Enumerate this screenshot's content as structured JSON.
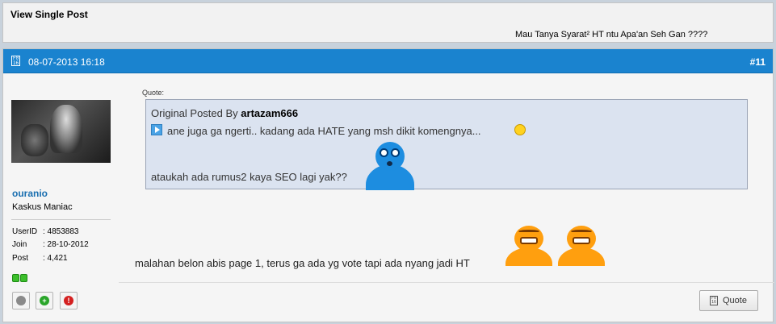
{
  "top": {
    "title": "View Single Post",
    "subject": "Mau Tanya Syarat² HT ntu Apa'an Seh Gan ????"
  },
  "post": {
    "date": "08-07-2013 16:18",
    "number": "#11",
    "date_icon_text": "F0 16"
  },
  "user": {
    "name": "ouranio",
    "title": "Kaskus Maniac",
    "info": [
      {
        "key": "UserID",
        "value": ": 4853883"
      },
      {
        "key": "Join",
        "value": ": 28-10-2012"
      },
      {
        "key": "Post",
        "value": ": 4,421"
      }
    ]
  },
  "quote": {
    "label": "Quote:",
    "posted_by_prefix": "Original Posted By ",
    "author": "artazam666",
    "line1": "ane juga ga ngerti.. kadang ada HATE yang msh dikit komengnya...",
    "line2": "ataukah ada rumus2 kaya SEO lagi yak??"
  },
  "message": "malahan belon abis page 1, terus ga ada yg vote tapi ada nyang jadi HT",
  "buttons": {
    "quote": "Quote",
    "add": "+",
    "report": "!"
  },
  "colors": {
    "header_blue": "#1a83cf",
    "username_blue": "#1a6fb0",
    "quote_bg": "#dbe3f0",
    "rep_green": "#3cbf2c"
  },
  "icons": [
    "calendar-icon",
    "play-icon",
    "smiley-icon",
    "blue-emoticon",
    "laughing-emoticon",
    "quote-icon",
    "reputation-icon",
    "add-friend-icon",
    "report-icon"
  ]
}
